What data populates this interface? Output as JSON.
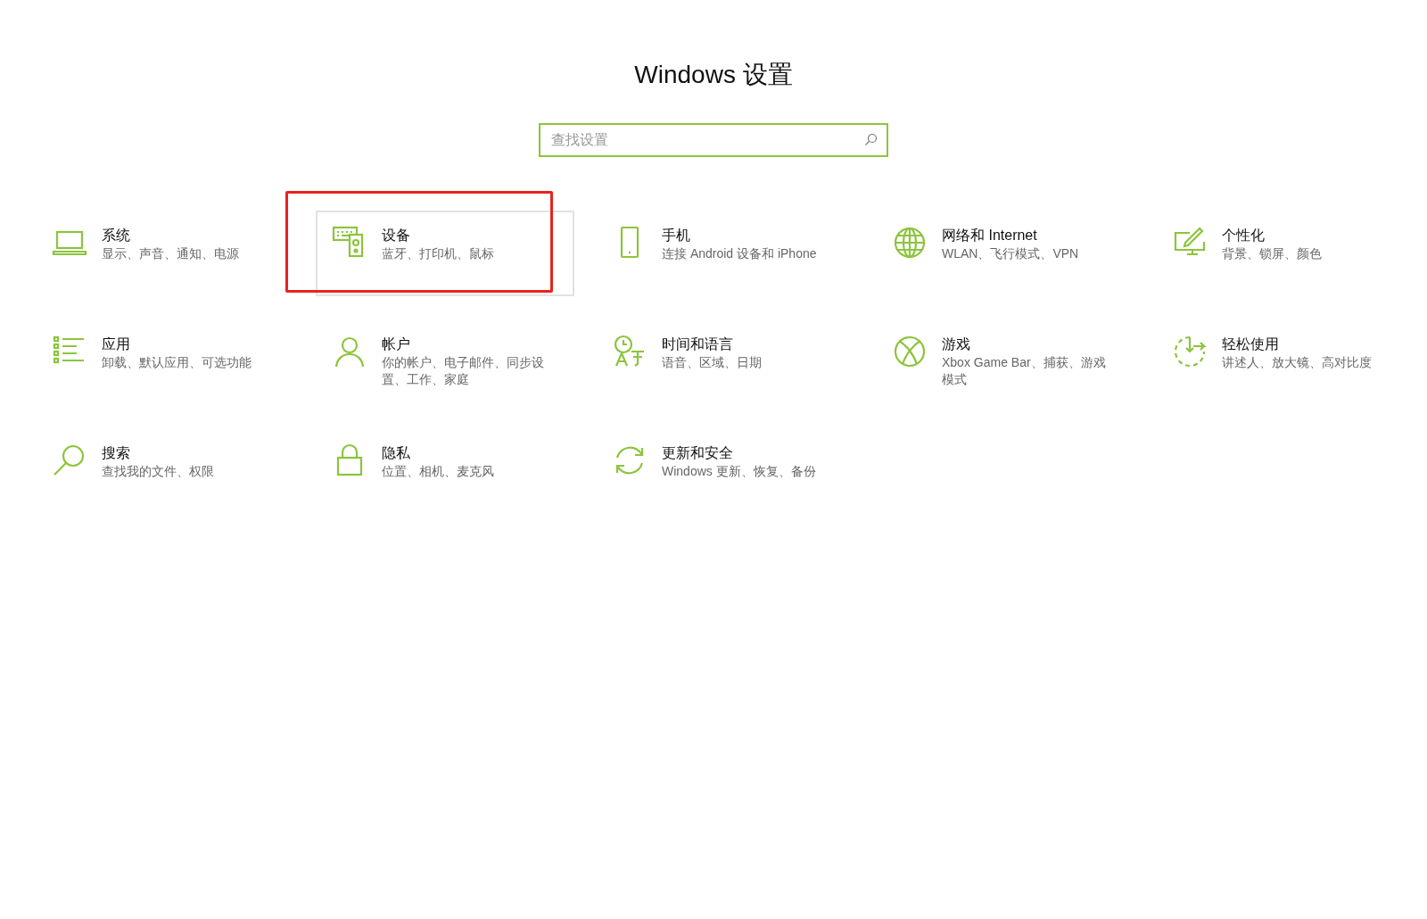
{
  "window": {
    "title": "Windows 设置"
  },
  "search": {
    "placeholder": "查找设置"
  },
  "tiles": [
    {
      "title": "系统",
      "description": "显示、声音、通知、电源",
      "hovered": false,
      "highlighted": false
    },
    {
      "title": "设备",
      "description": "蓝牙、打印机、鼠标",
      "hovered": true,
      "highlighted": true
    },
    {
      "title": "手机",
      "description": "连接 Android 设备和 iPhone",
      "hovered": false,
      "highlighted": false
    },
    {
      "title": "网络和 Internet",
      "description": "WLAN、飞行模式、VPN",
      "hovered": false,
      "highlighted": false
    },
    {
      "title": "个性化",
      "description": "背景、锁屏、颜色",
      "hovered": false,
      "highlighted": false
    },
    {
      "title": "应用",
      "description": "卸载、默认应用、可选功能",
      "hovered": false,
      "highlighted": false
    },
    {
      "title": "帐户",
      "description": "你的帐户、电子邮件、同步设置、工作、家庭",
      "hovered": false,
      "highlighted": false
    },
    {
      "title": "时间和语言",
      "description": "语音、区域、日期",
      "hovered": false,
      "highlighted": false
    },
    {
      "title": "游戏",
      "description": "Xbox Game Bar、捕获、游戏模式",
      "hovered": false,
      "highlighted": false
    },
    {
      "title": "轻松使用",
      "description": "讲述人、放大镜、高对比度",
      "hovered": false,
      "highlighted": false
    },
    {
      "title": "搜索",
      "description": "查找我的文件、权限",
      "hovered": false,
      "highlighted": false
    },
    {
      "title": "隐私",
      "description": "位置、相机、麦克风",
      "hovered": false,
      "highlighted": false
    },
    {
      "title": "更新和安全",
      "description": "Windows 更新、恢复、备份",
      "hovered": false,
      "highlighted": false
    }
  ]
}
